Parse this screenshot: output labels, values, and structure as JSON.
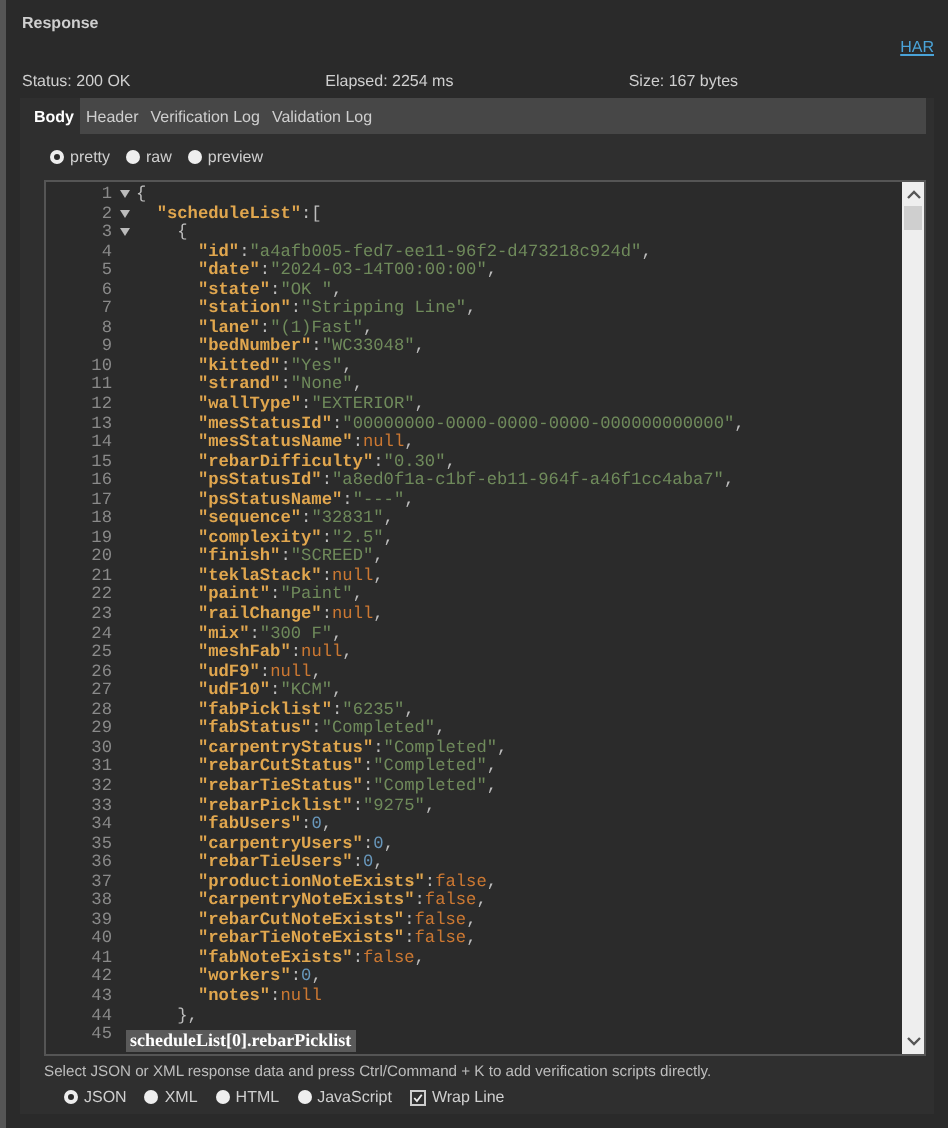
{
  "panel": {
    "title": "Response",
    "har_link": "HAR"
  },
  "status": {
    "status": "Status: 200 OK",
    "elapsed": "Elapsed: 2254 ms",
    "size": "Size: 167 bytes"
  },
  "tabs": [
    {
      "label": "Body",
      "selected": true
    },
    {
      "label": "Header",
      "selected": false
    },
    {
      "label": "Verification Log",
      "selected": false
    },
    {
      "label": "Validation Log",
      "selected": false
    }
  ],
  "view_modes": [
    {
      "label": "pretty",
      "selected": true
    },
    {
      "label": "raw",
      "selected": false
    },
    {
      "label": "preview",
      "selected": false
    }
  ],
  "editor": {
    "lines": [
      {
        "num": "1",
        "fold": true,
        "tokens": [
          {
            "kind": "punct",
            "text": "{"
          }
        ]
      },
      {
        "num": "2",
        "fold": true,
        "tokens": [
          {
            "kind": "key",
            "text": "  \"scheduleList\""
          },
          {
            "kind": "punct",
            "text": ":["
          }
        ]
      },
      {
        "num": "3",
        "fold": true,
        "tokens": [
          {
            "kind": "punct",
            "text": "    {"
          }
        ]
      },
      {
        "num": "4",
        "fold": false,
        "tokens": [
          {
            "kind": "key",
            "text": "      \"id\""
          },
          {
            "kind": "punct",
            "text": ":"
          },
          {
            "kind": "string",
            "text": "\"a4afb005-fed7-ee11-96f2-d473218c924d\""
          },
          {
            "kind": "punct",
            "text": ","
          }
        ]
      },
      {
        "num": "5",
        "fold": false,
        "tokens": [
          {
            "kind": "key",
            "text": "      \"date\""
          },
          {
            "kind": "punct",
            "text": ":"
          },
          {
            "kind": "string",
            "text": "\"2024-03-14T00:00:00\""
          },
          {
            "kind": "punct",
            "text": ","
          }
        ]
      },
      {
        "num": "6",
        "fold": false,
        "tokens": [
          {
            "kind": "key",
            "text": "      \"state\""
          },
          {
            "kind": "punct",
            "text": ":"
          },
          {
            "kind": "string",
            "text": "\"OK \""
          },
          {
            "kind": "punct",
            "text": ","
          }
        ]
      },
      {
        "num": "7",
        "fold": false,
        "tokens": [
          {
            "kind": "key",
            "text": "      \"station\""
          },
          {
            "kind": "punct",
            "text": ":"
          },
          {
            "kind": "string",
            "text": "\"Stripping Line\""
          },
          {
            "kind": "punct",
            "text": ","
          }
        ]
      },
      {
        "num": "8",
        "fold": false,
        "tokens": [
          {
            "kind": "key",
            "text": "      \"lane\""
          },
          {
            "kind": "punct",
            "text": ":"
          },
          {
            "kind": "string",
            "text": "\"(1)Fast\""
          },
          {
            "kind": "punct",
            "text": ","
          }
        ]
      },
      {
        "num": "9",
        "fold": false,
        "tokens": [
          {
            "kind": "key",
            "text": "      \"bedNumber\""
          },
          {
            "kind": "punct",
            "text": ":"
          },
          {
            "kind": "string",
            "text": "\"WC33048\""
          },
          {
            "kind": "punct",
            "text": ","
          }
        ]
      },
      {
        "num": "10",
        "fold": false,
        "tokens": [
          {
            "kind": "key",
            "text": "      \"kitted\""
          },
          {
            "kind": "punct",
            "text": ":"
          },
          {
            "kind": "string",
            "text": "\"Yes\""
          },
          {
            "kind": "punct",
            "text": ","
          }
        ]
      },
      {
        "num": "11",
        "fold": false,
        "tokens": [
          {
            "kind": "key",
            "text": "      \"strand\""
          },
          {
            "kind": "punct",
            "text": ":"
          },
          {
            "kind": "string",
            "text": "\"None\""
          },
          {
            "kind": "punct",
            "text": ","
          }
        ]
      },
      {
        "num": "12",
        "fold": false,
        "tokens": [
          {
            "kind": "key",
            "text": "      \"wallType\""
          },
          {
            "kind": "punct",
            "text": ":"
          },
          {
            "kind": "string",
            "text": "\"EXTERIOR\""
          },
          {
            "kind": "punct",
            "text": ","
          }
        ]
      },
      {
        "num": "13",
        "fold": false,
        "tokens": [
          {
            "kind": "key",
            "text": "      \"mesStatusId\""
          },
          {
            "kind": "punct",
            "text": ":"
          },
          {
            "kind": "string",
            "text": "\"00000000-0000-0000-0000-000000000000\""
          },
          {
            "kind": "punct",
            "text": ","
          }
        ]
      },
      {
        "num": "14",
        "fold": false,
        "tokens": [
          {
            "kind": "key",
            "text": "      \"mesStatusName\""
          },
          {
            "kind": "punct",
            "text": ":"
          },
          {
            "kind": "null",
            "text": "null"
          },
          {
            "kind": "punct",
            "text": ","
          }
        ]
      },
      {
        "num": "15",
        "fold": false,
        "tokens": [
          {
            "kind": "key",
            "text": "      \"rebarDifficulty\""
          },
          {
            "kind": "punct",
            "text": ":"
          },
          {
            "kind": "string",
            "text": "\"0.30\""
          },
          {
            "kind": "punct",
            "text": ","
          }
        ]
      },
      {
        "num": "16",
        "fold": false,
        "tokens": [
          {
            "kind": "key",
            "text": "      \"psStatusId\""
          },
          {
            "kind": "punct",
            "text": ":"
          },
          {
            "kind": "string",
            "text": "\"a8ed0f1a-c1bf-eb11-964f-a46f1cc4aba7\""
          },
          {
            "kind": "punct",
            "text": ","
          }
        ]
      },
      {
        "num": "17",
        "fold": false,
        "tokens": [
          {
            "kind": "key",
            "text": "      \"psStatusName\""
          },
          {
            "kind": "punct",
            "text": ":"
          },
          {
            "kind": "string",
            "text": "\"---\""
          },
          {
            "kind": "punct",
            "text": ","
          }
        ]
      },
      {
        "num": "18",
        "fold": false,
        "tokens": [
          {
            "kind": "key",
            "text": "      \"sequence\""
          },
          {
            "kind": "punct",
            "text": ":"
          },
          {
            "kind": "string",
            "text": "\"32831\""
          },
          {
            "kind": "punct",
            "text": ","
          }
        ]
      },
      {
        "num": "19",
        "fold": false,
        "tokens": [
          {
            "kind": "key",
            "text": "      \"complexity\""
          },
          {
            "kind": "punct",
            "text": ":"
          },
          {
            "kind": "string",
            "text": "\"2.5\""
          },
          {
            "kind": "punct",
            "text": ","
          }
        ]
      },
      {
        "num": "20",
        "fold": false,
        "tokens": [
          {
            "kind": "key",
            "text": "      \"finish\""
          },
          {
            "kind": "punct",
            "text": ":"
          },
          {
            "kind": "string",
            "text": "\"SCREED\""
          },
          {
            "kind": "punct",
            "text": ","
          }
        ]
      },
      {
        "num": "21",
        "fold": false,
        "tokens": [
          {
            "kind": "key",
            "text": "      \"teklaStack\""
          },
          {
            "kind": "punct",
            "text": ":"
          },
          {
            "kind": "null",
            "text": "null"
          },
          {
            "kind": "punct",
            "text": ","
          }
        ]
      },
      {
        "num": "22",
        "fold": false,
        "tokens": [
          {
            "kind": "key",
            "text": "      \"paint\""
          },
          {
            "kind": "punct",
            "text": ":"
          },
          {
            "kind": "string",
            "text": "\"Paint\""
          },
          {
            "kind": "punct",
            "text": ","
          }
        ]
      },
      {
        "num": "23",
        "fold": false,
        "tokens": [
          {
            "kind": "key",
            "text": "      \"railChange\""
          },
          {
            "kind": "punct",
            "text": ":"
          },
          {
            "kind": "null",
            "text": "null"
          },
          {
            "kind": "punct",
            "text": ","
          }
        ]
      },
      {
        "num": "24",
        "fold": false,
        "tokens": [
          {
            "kind": "key",
            "text": "      \"mix\""
          },
          {
            "kind": "punct",
            "text": ":"
          },
          {
            "kind": "string",
            "text": "\"300 F\""
          },
          {
            "kind": "punct",
            "text": ","
          }
        ]
      },
      {
        "num": "25",
        "fold": false,
        "tokens": [
          {
            "kind": "key",
            "text": "      \"meshFab\""
          },
          {
            "kind": "punct",
            "text": ":"
          },
          {
            "kind": "null",
            "text": "null"
          },
          {
            "kind": "punct",
            "text": ","
          }
        ]
      },
      {
        "num": "26",
        "fold": false,
        "tokens": [
          {
            "kind": "key",
            "text": "      \"udF9\""
          },
          {
            "kind": "punct",
            "text": ":"
          },
          {
            "kind": "null",
            "text": "null"
          },
          {
            "kind": "punct",
            "text": ","
          }
        ]
      },
      {
        "num": "27",
        "fold": false,
        "tokens": [
          {
            "kind": "key",
            "text": "      \"udF10\""
          },
          {
            "kind": "punct",
            "text": ":"
          },
          {
            "kind": "string",
            "text": "\"KCM\""
          },
          {
            "kind": "punct",
            "text": ","
          }
        ]
      },
      {
        "num": "28",
        "fold": false,
        "tokens": [
          {
            "kind": "key",
            "text": "      \"fabPicklist\""
          },
          {
            "kind": "punct",
            "text": ":"
          },
          {
            "kind": "string",
            "text": "\"6235\""
          },
          {
            "kind": "punct",
            "text": ","
          }
        ]
      },
      {
        "num": "29",
        "fold": false,
        "tokens": [
          {
            "kind": "key",
            "text": "      \"fabStatus\""
          },
          {
            "kind": "punct",
            "text": ":"
          },
          {
            "kind": "string",
            "text": "\"Completed\""
          },
          {
            "kind": "punct",
            "text": ","
          }
        ]
      },
      {
        "num": "30",
        "fold": false,
        "tokens": [
          {
            "kind": "key",
            "text": "      \"carpentryStatus\""
          },
          {
            "kind": "punct",
            "text": ":"
          },
          {
            "kind": "string",
            "text": "\"Completed\""
          },
          {
            "kind": "punct",
            "text": ","
          }
        ]
      },
      {
        "num": "31",
        "fold": false,
        "tokens": [
          {
            "kind": "key",
            "text": "      \"rebarCutStatus\""
          },
          {
            "kind": "punct",
            "text": ":"
          },
          {
            "kind": "string",
            "text": "\"Completed\""
          },
          {
            "kind": "punct",
            "text": ","
          }
        ]
      },
      {
        "num": "32",
        "fold": false,
        "tokens": [
          {
            "kind": "key",
            "text": "      \"rebarTieStatus\""
          },
          {
            "kind": "punct",
            "text": ":"
          },
          {
            "kind": "string",
            "text": "\"Completed\""
          },
          {
            "kind": "punct",
            "text": ","
          }
        ]
      },
      {
        "num": "33",
        "fold": false,
        "tokens": [
          {
            "kind": "key",
            "text": "      \"rebarPicklist\""
          },
          {
            "kind": "punct",
            "text": ":"
          },
          {
            "kind": "string",
            "text": "\"9275\""
          },
          {
            "kind": "punct",
            "text": ","
          }
        ]
      },
      {
        "num": "34",
        "fold": false,
        "tokens": [
          {
            "kind": "key",
            "text": "      \"fabUsers\""
          },
          {
            "kind": "punct",
            "text": ":"
          },
          {
            "kind": "number",
            "text": "0"
          },
          {
            "kind": "punct",
            "text": ","
          }
        ]
      },
      {
        "num": "35",
        "fold": false,
        "tokens": [
          {
            "kind": "key",
            "text": "      \"carpentryUsers\""
          },
          {
            "kind": "punct",
            "text": ":"
          },
          {
            "kind": "number",
            "text": "0"
          },
          {
            "kind": "punct",
            "text": ","
          }
        ]
      },
      {
        "num": "36",
        "fold": false,
        "tokens": [
          {
            "kind": "key",
            "text": "      \"rebarTieUsers\""
          },
          {
            "kind": "punct",
            "text": ":"
          },
          {
            "kind": "number",
            "text": "0"
          },
          {
            "kind": "punct",
            "text": ","
          }
        ]
      },
      {
        "num": "37",
        "fold": false,
        "tokens": [
          {
            "kind": "key",
            "text": "      \"productionNoteExists\""
          },
          {
            "kind": "punct",
            "text": ":"
          },
          {
            "kind": "bool",
            "text": "false"
          },
          {
            "kind": "punct",
            "text": ","
          }
        ]
      },
      {
        "num": "38",
        "fold": false,
        "tokens": [
          {
            "kind": "key",
            "text": "      \"carpentryNoteExists\""
          },
          {
            "kind": "punct",
            "text": ":"
          },
          {
            "kind": "bool",
            "text": "false"
          },
          {
            "kind": "punct",
            "text": ","
          }
        ]
      },
      {
        "num": "39",
        "fold": false,
        "tokens": [
          {
            "kind": "key",
            "text": "      \"rebarCutNoteExists\""
          },
          {
            "kind": "punct",
            "text": ":"
          },
          {
            "kind": "bool",
            "text": "false"
          },
          {
            "kind": "punct",
            "text": ","
          }
        ]
      },
      {
        "num": "40",
        "fold": false,
        "tokens": [
          {
            "kind": "key",
            "text": "      \"rebarTieNoteExists\""
          },
          {
            "kind": "punct",
            "text": ":"
          },
          {
            "kind": "bool",
            "text": "false"
          },
          {
            "kind": "punct",
            "text": ","
          }
        ]
      },
      {
        "num": "41",
        "fold": false,
        "tokens": [
          {
            "kind": "key",
            "text": "      \"fabNoteExists\""
          },
          {
            "kind": "punct",
            "text": ":"
          },
          {
            "kind": "bool",
            "text": "false"
          },
          {
            "kind": "punct",
            "text": ","
          }
        ]
      },
      {
        "num": "42",
        "fold": false,
        "tokens": [
          {
            "kind": "key",
            "text": "      \"workers\""
          },
          {
            "kind": "punct",
            "text": ":"
          },
          {
            "kind": "number",
            "text": "0"
          },
          {
            "kind": "punct",
            "text": ","
          }
        ]
      },
      {
        "num": "43",
        "fold": false,
        "tokens": [
          {
            "kind": "key",
            "text": "      \"notes\""
          },
          {
            "kind": "punct",
            "text": ":"
          },
          {
            "kind": "null",
            "text": "null"
          }
        ]
      },
      {
        "num": "44",
        "fold": false,
        "tokens": [
          {
            "kind": "punct",
            "text": "    },"
          }
        ]
      },
      {
        "num": "45",
        "fold": false
      }
    ],
    "tooltip": "scheduleList[0].rebarPicklist"
  },
  "hint": "Select JSON or XML response data and press Ctrl/Command + K to add verification scripts directly.",
  "formats": [
    {
      "label": "JSON",
      "selected": true
    },
    {
      "label": "XML",
      "selected": false
    },
    {
      "label": "HTML",
      "selected": false
    },
    {
      "label": "JavaScript",
      "selected": false
    }
  ],
  "wrap_line": {
    "label": "Wrap Line",
    "checked": true
  }
}
